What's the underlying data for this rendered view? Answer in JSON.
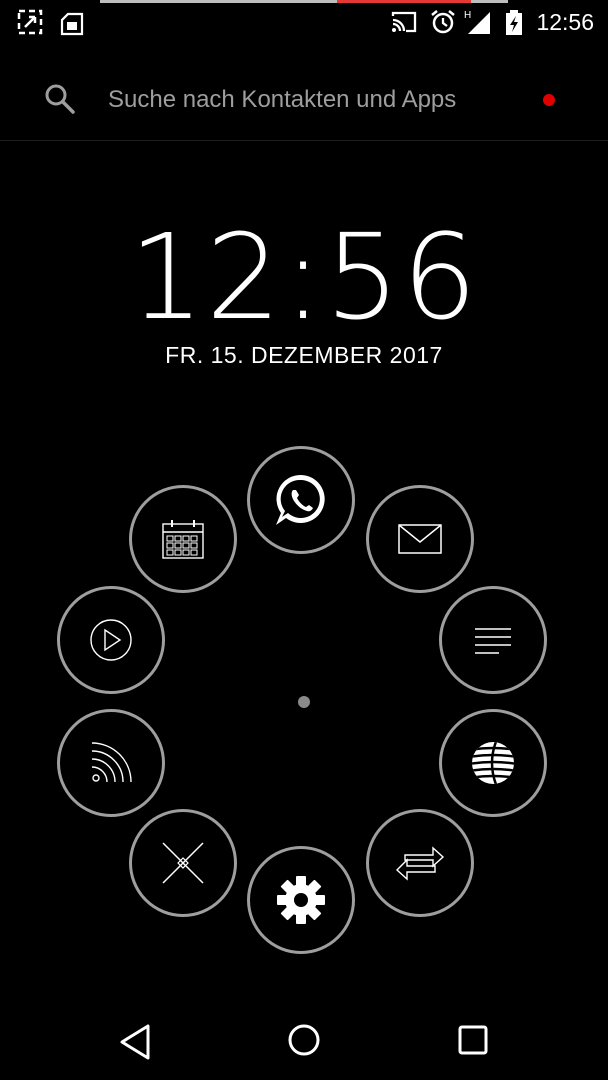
{
  "status_bar": {
    "time": "12:56",
    "network_label": "H",
    "icons": [
      "screenshot-expand-icon",
      "sim-card-icon",
      "cast-icon",
      "alarm-icon",
      "signal-icon",
      "battery-charging-icon"
    ],
    "progress": 0.33,
    "progress_color": "#e53935"
  },
  "search": {
    "placeholder": "Suche nach Kontakten und Apps",
    "indicator_color": "#e00000"
  },
  "clock": {
    "time": "12:56",
    "date": "FR. 15. DEZEMBER 2017"
  },
  "app_ring": {
    "items": [
      "whatsapp-icon",
      "mail-icon",
      "notes-icon",
      "att-globe-icon",
      "sync-arrows-icon",
      "settings-gear-icon",
      "tools-cross-icon",
      "wifi-cast-icon",
      "play-icon",
      "calendar-icon"
    ],
    "border_color": "#9e9e9e"
  },
  "nav_bar": {
    "buttons": [
      "back-triangle-icon",
      "home-circle-icon",
      "recents-square-icon"
    ]
  }
}
